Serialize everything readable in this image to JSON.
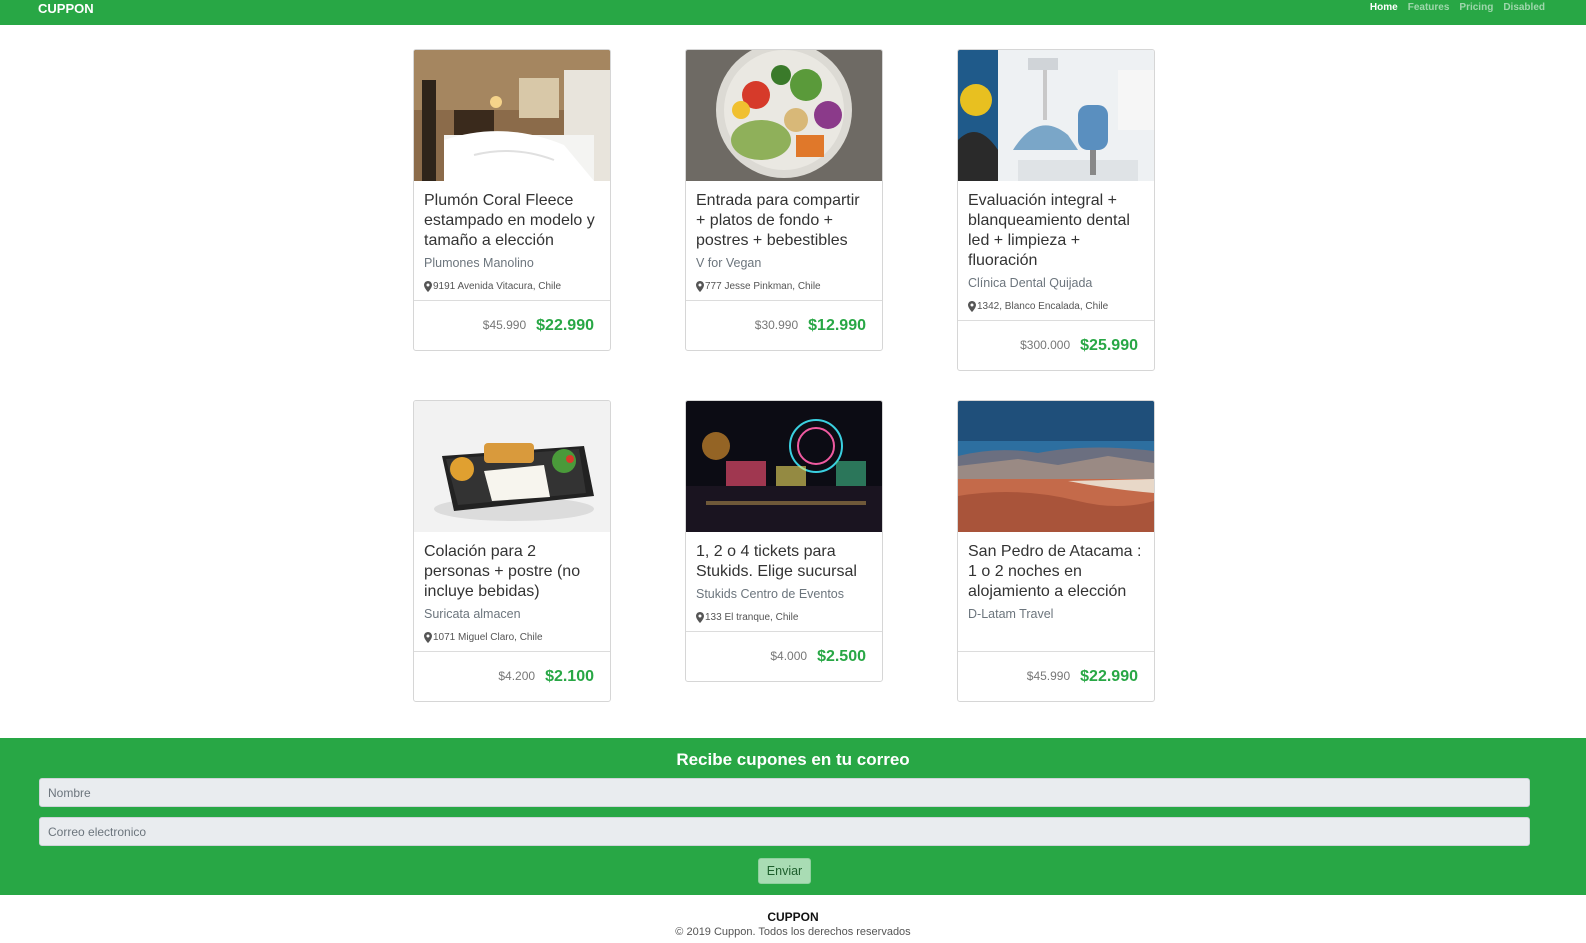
{
  "nav": {
    "brand": "CUPPON",
    "links": [
      {
        "label": "Home",
        "active": true
      },
      {
        "label": "Features",
        "active": false
      },
      {
        "label": "Pricing",
        "active": false
      },
      {
        "label": "Disabled",
        "active": false
      }
    ]
  },
  "coupons": [
    {
      "title": "Plumón Coral Fleece estampado en modelo y tamaño a elección",
      "merchant": "Plumones Manolino",
      "address": "9191 Avenida Vitacura, Chile",
      "old_price": "$45.990",
      "price": "$22.990",
      "image": "bedroom-photo"
    },
    {
      "title": "Entrada para compartir + platos de fondo + postres + bebestibles",
      "merchant": "V for Vegan",
      "address": "777 Jesse Pinkman, Chile",
      "old_price": "$30.990",
      "price": "$12.990",
      "image": "vegan-bowl-photo"
    },
    {
      "title": "Evaluación integral + blanqueamiento dental led + limpieza + fluoración",
      "merchant": "Clínica Dental Quijada",
      "address": "1342, Blanco Encalada, Chile",
      "old_price": "$300.000",
      "price": "$25.990",
      "image": "dental-clinic-photo"
    },
    {
      "title": "Colación para 2 personas + postre (no incluye bebidas)",
      "merchant": "Suricata almacen",
      "address": "1071 Miguel Claro, Chile",
      "old_price": "$4.200",
      "price": "$2.100",
      "image": "bento-box-photo"
    },
    {
      "title": "1, 2 o 4 tickets para Stukids. Elige sucursal",
      "merchant": "Stukids Centro de Eventos",
      "address": "133 El tranque, Chile",
      "old_price": "$4.000",
      "price": "$2.500",
      "image": "fairground-night-photo"
    },
    {
      "title": "San Pedro de Atacama : 1 o 2 noches en alojamiento a elección",
      "merchant": "D-Latam Travel",
      "address": "",
      "old_price": "$45.990",
      "price": "$22.990",
      "image": "atacama-desert-photo"
    }
  ],
  "subscribe": {
    "title": "Recibe cupones en tu correo",
    "name_placeholder": "Nombre",
    "email_placeholder": "Correo electronico",
    "button": "Enviar"
  },
  "footer": {
    "brand": "CUPPON",
    "copyright": "© 2019 Cuppon. Todos los derechos reservados"
  },
  "colors": {
    "brand_green": "#28a745",
    "input_bg": "#e9ecef"
  }
}
